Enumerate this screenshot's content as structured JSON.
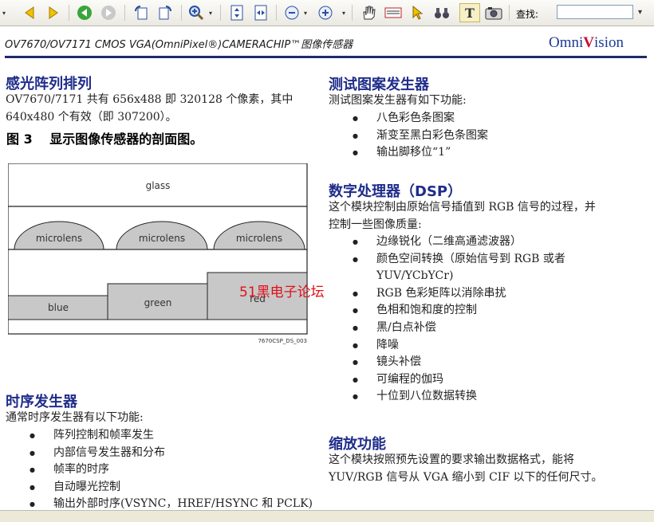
{
  "toolbar": {
    "find_label": "查找:",
    "find_value": ""
  },
  "document": {
    "header_title": "OV7670/OV7171 CMOS VGA(OmniPixel®)CAMERACHIP™图像传感器",
    "logo": {
      "prefix": "Omni",
      "mark": "V",
      "suffix": "ision"
    },
    "left": {
      "section1": {
        "heading": "感光阵列排列",
        "text_line1": "OV7670/7171 共有 656x488 即 320128 个像素，其中",
        "text_line2": "640x480 个有效（即 307200）。"
      },
      "figure_title": "图 3　 显示图像传感器的剖面图。",
      "figure": {
        "glass": "glass",
        "microlens1": "microlens",
        "microlens2": "microlens",
        "microlens3": "microlens",
        "blue": "blue",
        "green": "green",
        "red": "red",
        "code": "7670CSP_DS_003"
      },
      "section2": {
        "heading": "时序发生器",
        "intro": "通常时序发生器有以下功能:",
        "items": [
          "阵列控制和帧率发生",
          "内部信号发生器和分布",
          "帧率的时序",
          "自动曝光控制",
          "输出外部时序(VSYNC，HREF/HSYNC 和 PCLK)"
        ]
      }
    },
    "right": {
      "section1": {
        "heading": "测试图案发生器",
        "intro": "测试图案发生器有如下功能:",
        "items": [
          "八色彩色条图案",
          "渐变至黑白彩色条图案",
          "输出脚移位“1”"
        ]
      },
      "section2": {
        "heading": "数字处理器（DSP）",
        "intro_line1": "这个模块控制由原始信号插值到 RGB 信号的过程，并",
        "intro_line2": "控制一些图像质量:",
        "items": [
          "边缘锐化（二维高通滤波器）",
          "颜色空间转换（原始信号到 RGB 或者",
          "RGB 色彩矩阵以消除串扰",
          "色相和饱和度的控制",
          "黑/白点补偿",
          "降噪",
          "镜头补偿",
          "可编程的伽玛",
          "十位到八位数据转换"
        ],
        "item2_line2": "YUV/YCbYCr)"
      },
      "section3": {
        "heading": "缩放功能",
        "text_line1": "这个模块按照预先设置的要求输出数据格式，能将",
        "text_line2": "YUV/RGB 信号从 VGA 缩小到 CIF 以下的任何尺寸。"
      }
    },
    "watermark": "51黑电子论坛"
  }
}
